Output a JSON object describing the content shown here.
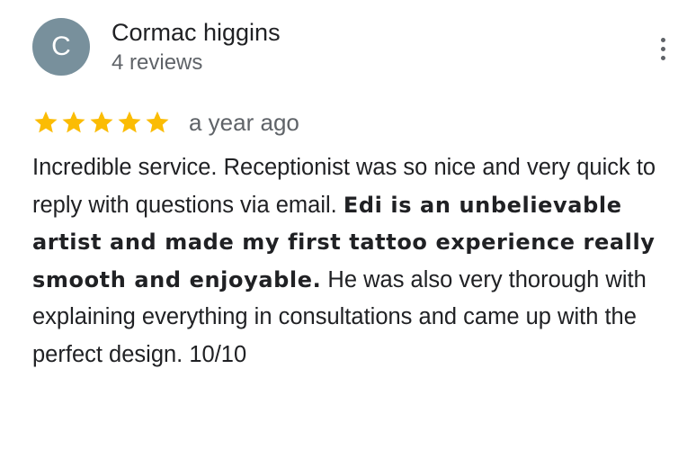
{
  "reviewer": {
    "initial": "C",
    "name": "Cormac higgins",
    "review_count": "4 reviews",
    "avatar_color": "#78909c"
  },
  "menu": {
    "icon": "more-vert-icon"
  },
  "review": {
    "rating": 5,
    "max_rating": 5,
    "star_color": "#fbbc04",
    "date": "a year ago",
    "text_part1": "Incredible service. Receptionist was so nice and very quick to reply with questions via email. ",
    "text_bold": "Edi is an unbelievable artist and made my first tattoo experience really smooth and enjoyable.",
    "text_part2": " He was also very thorough with explaining everything in consultations and came up with the perfect design. 10/10"
  }
}
